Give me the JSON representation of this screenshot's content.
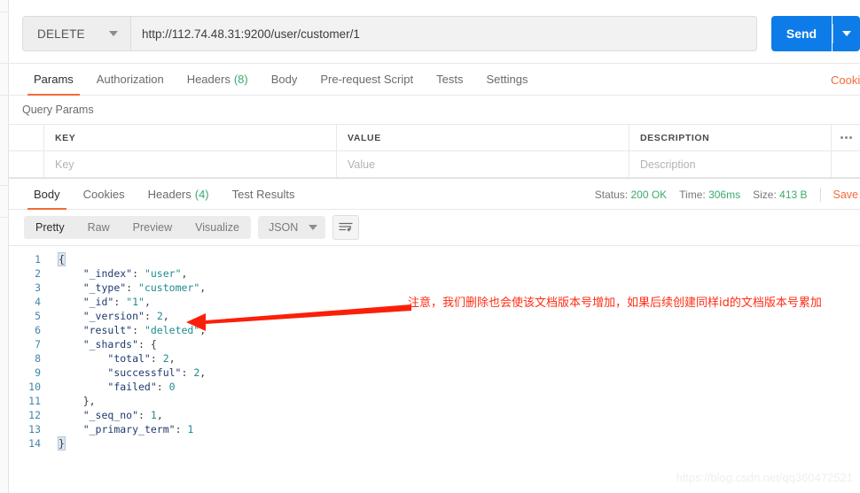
{
  "request": {
    "method": "DELETE",
    "url": "http://112.74.48.31:9200/user/customer/1",
    "send_label": "Send",
    "tabs": [
      {
        "label": "Params",
        "count": null,
        "active": true
      },
      {
        "label": "Authorization",
        "count": null,
        "active": false
      },
      {
        "label": "Headers",
        "count": "(8)",
        "active": false
      },
      {
        "label": "Body",
        "count": null,
        "active": false
      },
      {
        "label": "Pre-request Script",
        "count": null,
        "active": false
      },
      {
        "label": "Tests",
        "count": null,
        "active": false
      },
      {
        "label": "Settings",
        "count": null,
        "active": false
      }
    ],
    "cookies_link": "Cookies"
  },
  "query_params": {
    "title": "Query Params",
    "headers": {
      "key": "KEY",
      "value": "VALUE",
      "description": "DESCRIPTION"
    },
    "placeholders": {
      "key": "Key",
      "value": "Value",
      "description": "Description"
    }
  },
  "response": {
    "tabs": [
      {
        "label": "Body",
        "count": null,
        "active": true
      },
      {
        "label": "Cookies",
        "count": null,
        "active": false
      },
      {
        "label": "Headers",
        "count": "(4)",
        "active": false
      },
      {
        "label": "Test Results",
        "count": null,
        "active": false
      }
    ],
    "meta": {
      "status_label": "Status:",
      "status_value": "200 OK",
      "time_label": "Time:",
      "time_value": "306ms",
      "size_label": "Size:",
      "size_value": "413 B",
      "save_label": "Save"
    },
    "format_tabs": [
      {
        "label": "Pretty",
        "active": true
      },
      {
        "label": "Raw",
        "active": false
      },
      {
        "label": "Preview",
        "active": false
      },
      {
        "label": "Visualize",
        "active": false
      }
    ],
    "language": "JSON",
    "line_numbers": [
      "1",
      "2",
      "3",
      "4",
      "5",
      "6",
      "7",
      "8",
      "9",
      "10",
      "11",
      "12",
      "13",
      "14"
    ],
    "body_lines": [
      [
        {
          "t": "brace",
          "v": "{",
          "hl": true
        }
      ],
      [
        {
          "t": "punc",
          "v": "    "
        },
        {
          "t": "key",
          "v": "\"_index\""
        },
        {
          "t": "punc",
          "v": ": "
        },
        {
          "t": "str",
          "v": "\"user\""
        },
        {
          "t": "punc",
          "v": ","
        }
      ],
      [
        {
          "t": "punc",
          "v": "    "
        },
        {
          "t": "key",
          "v": "\"_type\""
        },
        {
          "t": "punc",
          "v": ": "
        },
        {
          "t": "str",
          "v": "\"customer\""
        },
        {
          "t": "punc",
          "v": ","
        }
      ],
      [
        {
          "t": "punc",
          "v": "    "
        },
        {
          "t": "key",
          "v": "\"_id\""
        },
        {
          "t": "punc",
          "v": ": "
        },
        {
          "t": "str",
          "v": "\"1\""
        },
        {
          "t": "punc",
          "v": ","
        }
      ],
      [
        {
          "t": "punc",
          "v": "    "
        },
        {
          "t": "key",
          "v": "\"_version\""
        },
        {
          "t": "punc",
          "v": ": "
        },
        {
          "t": "num",
          "v": "2"
        },
        {
          "t": "punc",
          "v": ","
        }
      ],
      [
        {
          "t": "punc",
          "v": "    "
        },
        {
          "t": "key",
          "v": "\"result\""
        },
        {
          "t": "punc",
          "v": ": "
        },
        {
          "t": "str",
          "v": "\"deleted\""
        },
        {
          "t": "punc",
          "v": ","
        }
      ],
      [
        {
          "t": "punc",
          "v": "    "
        },
        {
          "t": "key",
          "v": "\"_shards\""
        },
        {
          "t": "punc",
          "v": ": {"
        }
      ],
      [
        {
          "t": "punc",
          "v": "        "
        },
        {
          "t": "key",
          "v": "\"total\""
        },
        {
          "t": "punc",
          "v": ": "
        },
        {
          "t": "num",
          "v": "2"
        },
        {
          "t": "punc",
          "v": ","
        }
      ],
      [
        {
          "t": "punc",
          "v": "        "
        },
        {
          "t": "key",
          "v": "\"successful\""
        },
        {
          "t": "punc",
          "v": ": "
        },
        {
          "t": "num",
          "v": "2"
        },
        {
          "t": "punc",
          "v": ","
        }
      ],
      [
        {
          "t": "punc",
          "v": "        "
        },
        {
          "t": "key",
          "v": "\"failed\""
        },
        {
          "t": "punc",
          "v": ": "
        },
        {
          "t": "num",
          "v": "0"
        }
      ],
      [
        {
          "t": "punc",
          "v": "    "
        },
        {
          "t": "punc",
          "v": "},"
        }
      ],
      [
        {
          "t": "punc",
          "v": "    "
        },
        {
          "t": "key",
          "v": "\"_seq_no\""
        },
        {
          "t": "punc",
          "v": ": "
        },
        {
          "t": "num",
          "v": "1"
        },
        {
          "t": "punc",
          "v": ","
        }
      ],
      [
        {
          "t": "punc",
          "v": "    "
        },
        {
          "t": "key",
          "v": "\"_primary_term\""
        },
        {
          "t": "punc",
          "v": ": "
        },
        {
          "t": "num",
          "v": "1"
        }
      ],
      [
        {
          "t": "brace",
          "v": "}",
          "hl": true
        }
      ]
    ]
  },
  "annotation": {
    "text": "注意，我们删除也会使该文档版本号增加，如果后续创建同样id的文档版本号累加",
    "color": "#ff2d13"
  },
  "watermark": "https://blog.csdn.net/qq360472521",
  "colors": {
    "accent_orange": "#f26b3a",
    "send_blue": "#0d7ce8",
    "status_green": "#3aaa6d",
    "annotation_red": "#ff2d13"
  }
}
